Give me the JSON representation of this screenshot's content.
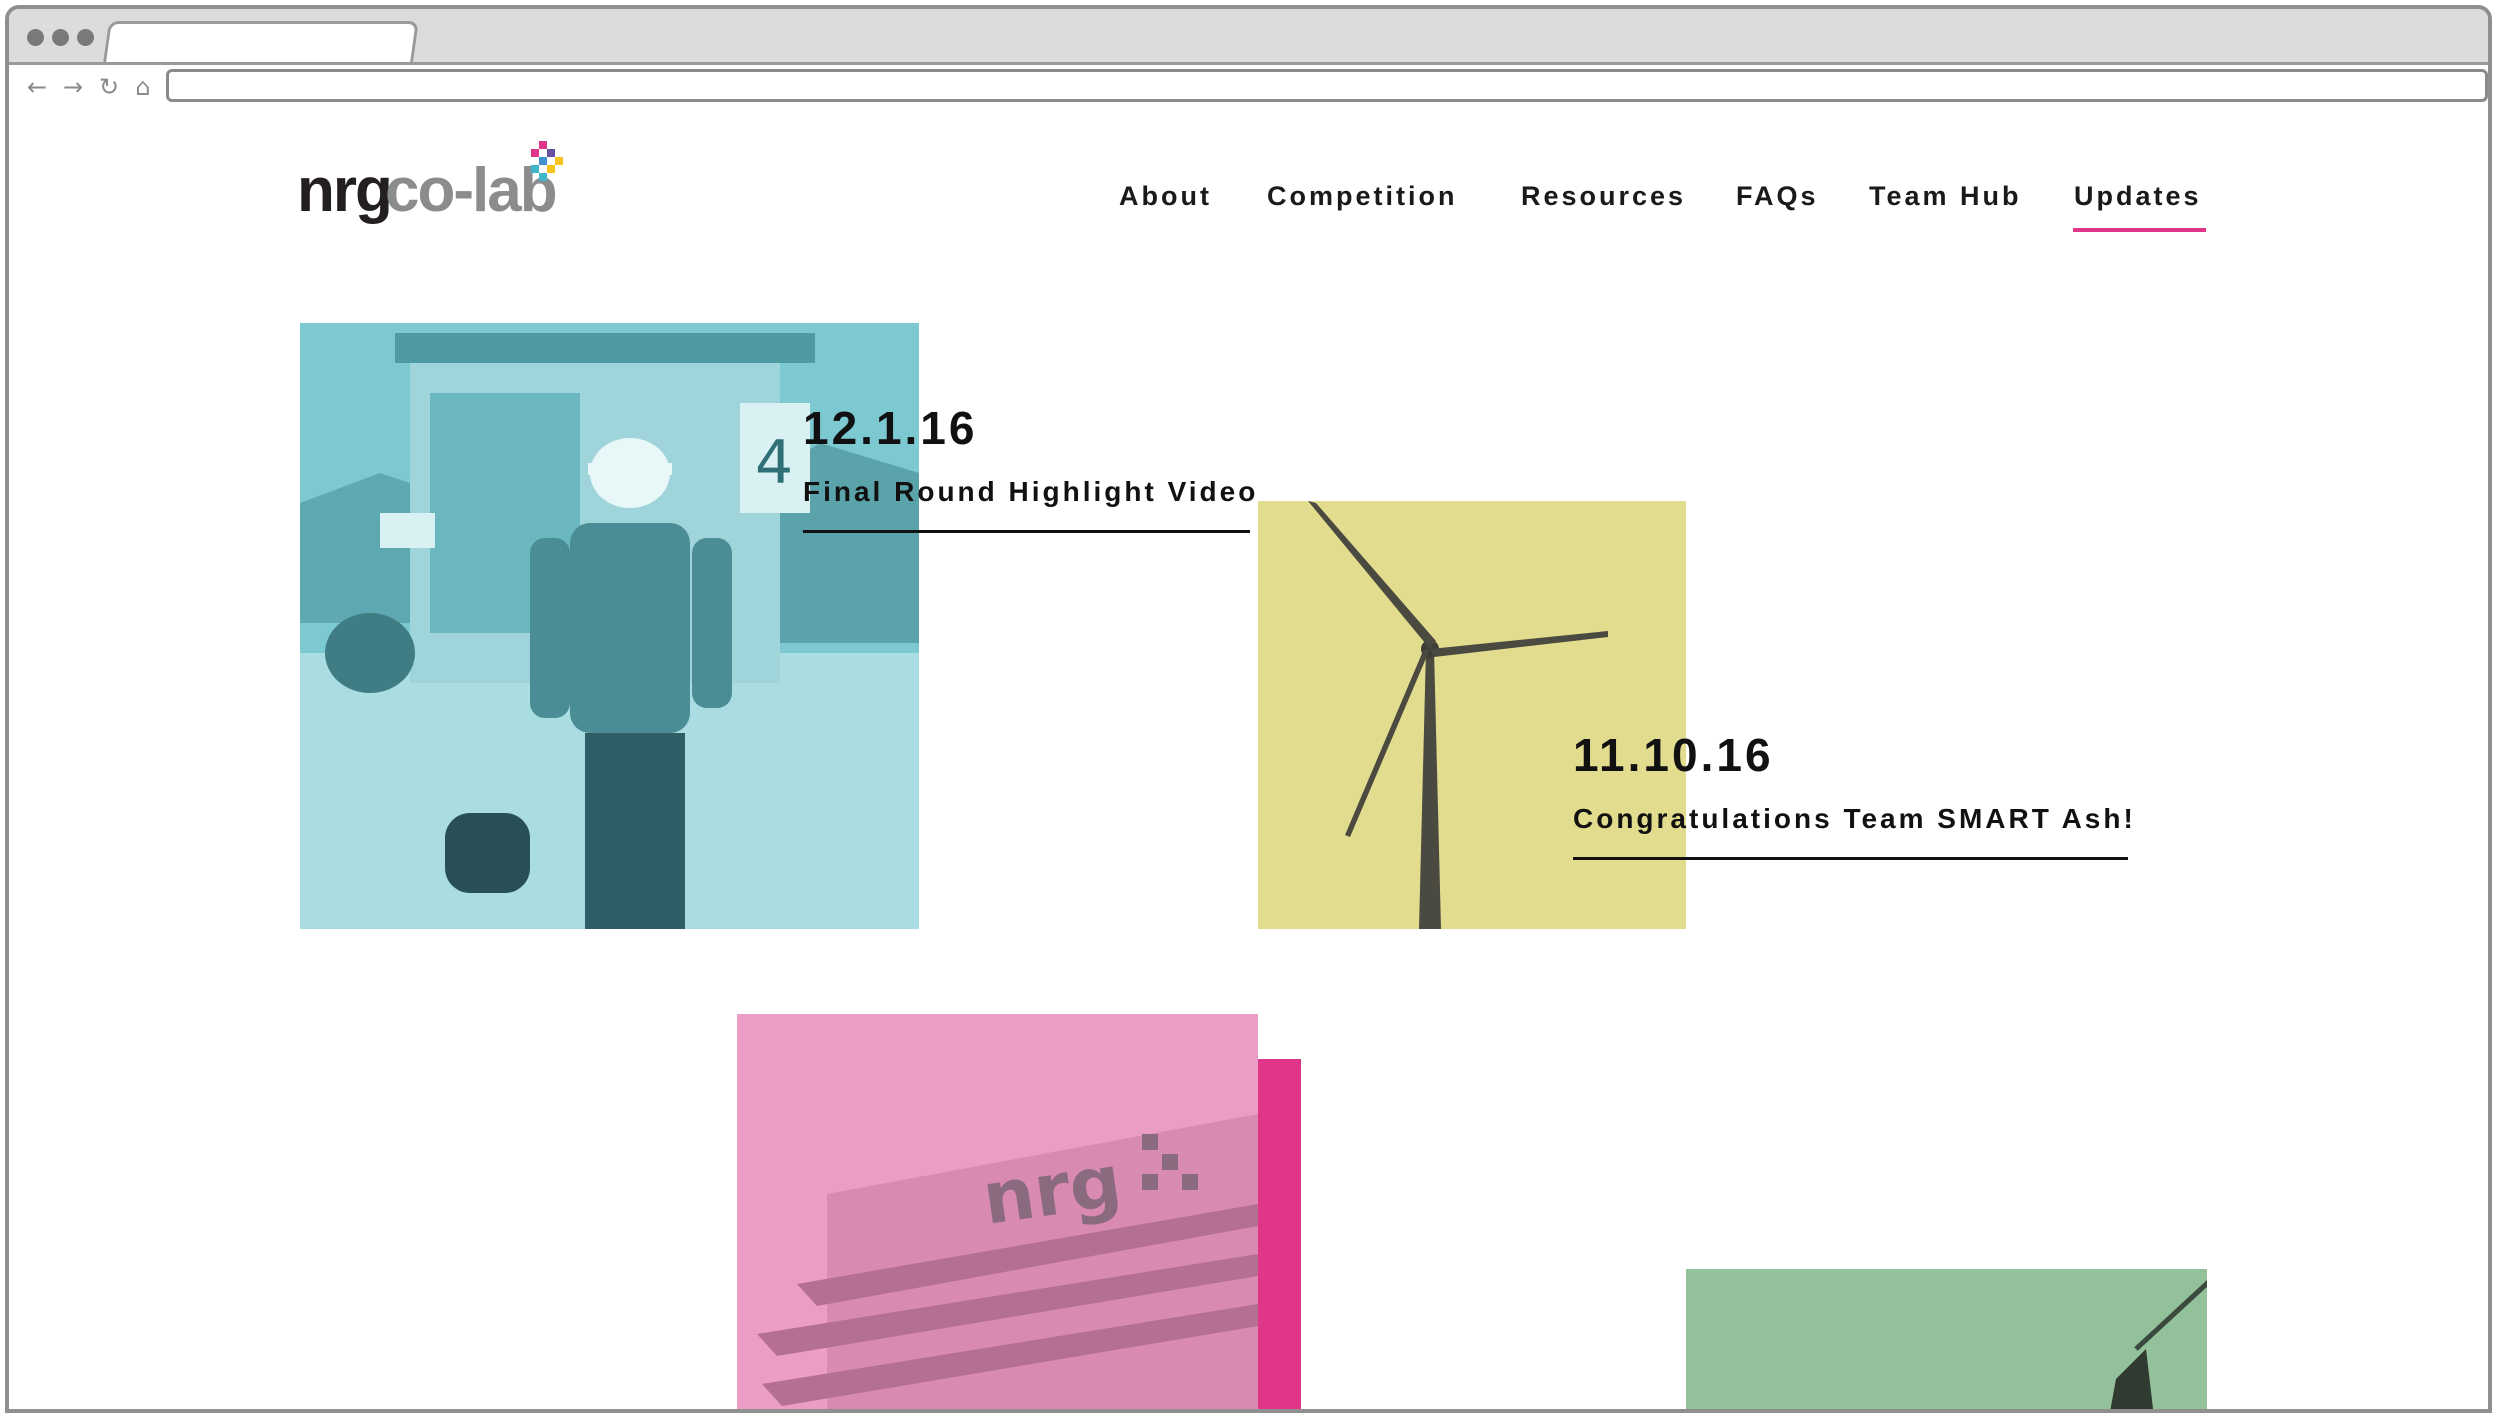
{
  "nav": {
    "items": [
      {
        "label": "About"
      },
      {
        "label": "Competition"
      },
      {
        "label": "Resources"
      },
      {
        "label": "FAQs"
      },
      {
        "label": "Team Hub"
      },
      {
        "label": "Updates"
      }
    ],
    "active": "Updates"
  },
  "logo": {
    "text_primary": "nrg",
    "text_secondary": "co-lab"
  },
  "posts": [
    {
      "date": "12.1.16",
      "title": "Final Round Highlight Video",
      "image_tint": "#6fc1c9"
    },
    {
      "date": "11.10.16",
      "title": "Congratulations Team SMART Ash!",
      "image_tint": "#e2dd8e"
    }
  ],
  "colors": {
    "accent_pink": "#e0368a",
    "teal": "#6fc1c9",
    "yellow": "#e2dd8e",
    "pink": "#ec9dc6",
    "green": "#8fbf97"
  },
  "browser": {
    "back_icon": "arrow-left-icon",
    "forward_icon": "arrow-right-icon",
    "reload_icon": "reload-icon",
    "home_icon": "home-icon"
  }
}
